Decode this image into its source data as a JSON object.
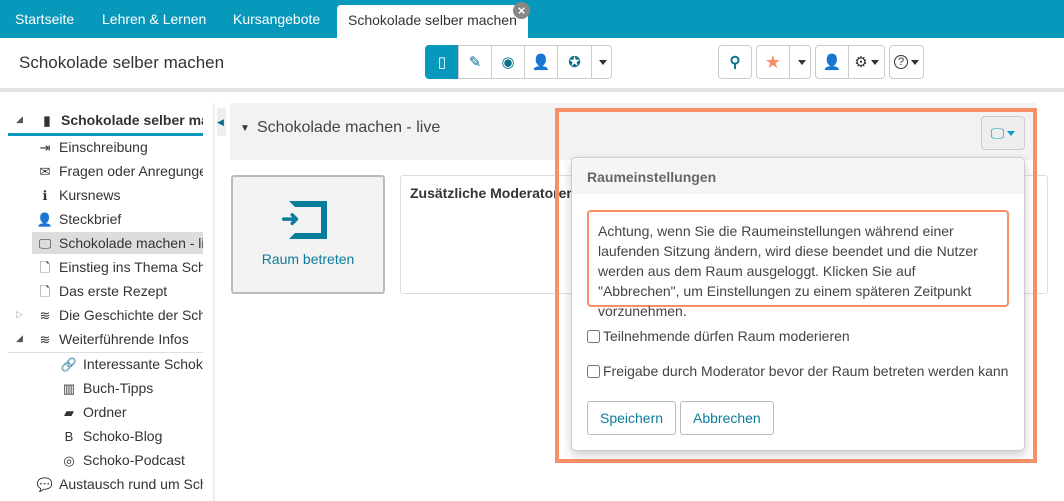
{
  "colors": {
    "brand": "#0898bb",
    "highlight": "#f79068"
  },
  "topnav": {
    "tabs": [
      "Startseite",
      "Lehren & Lernen",
      "Kursangebote"
    ],
    "active_tab": "Schokolade selber machen",
    "close": "×"
  },
  "header": {
    "title": "Schokolade selber machen"
  },
  "toolbar": {
    "icons": [
      "book-icon",
      "pencil-icon",
      "preview-icon",
      "members-icon",
      "assessment-icon"
    ],
    "caret": "more"
  },
  "tools": {
    "search": "search-icon",
    "favorite": "star-icon",
    "user": "user-globe-icon",
    "settings": "gears-icon",
    "help": "?"
  },
  "sidebar": {
    "root": "Schokolade selber machen",
    "items": [
      {
        "label": "Einschreibung",
        "icon": "⇥"
      },
      {
        "label": "Fragen oder Anregungen",
        "icon": "✉"
      },
      {
        "label": "Kursnews",
        "icon": "ℹ"
      },
      {
        "label": "Steckbrief",
        "icon": "👤"
      },
      {
        "label": "Schokolade machen - live",
        "icon": "🖵"
      },
      {
        "label": "Einstieg ins Thema Schokolade",
        "icon": "🗋"
      },
      {
        "label": "Das erste Rezept",
        "icon": "🗋"
      },
      {
        "label": "Die Geschichte der Schokolade",
        "icon": "≋"
      },
      {
        "label": "Weiterführende Infos",
        "icon": "≋"
      },
      {
        "label": "Interessante Schokoladenseiten",
        "icon": "🔗"
      },
      {
        "label": "Buch-Tipps",
        "icon": "▥"
      },
      {
        "label": "Ordner",
        "icon": "▰"
      },
      {
        "label": "Schoko-Blog",
        "icon": "B"
      },
      {
        "label": "Schoko-Podcast",
        "icon": "◎"
      },
      {
        "label": "Austausch rund um Schokolade",
        "icon": "💬"
      }
    ]
  },
  "main": {
    "title": "Schokolade machen - live",
    "room_button": "Raum betreten",
    "moderators_label": "Zusätzliche Moderatoren:"
  },
  "popover": {
    "title": "Raumeinstellungen",
    "warning": "Achtung, wenn Sie die Raumeinstellungen während einer laufenden Sitzung ändern, wird diese beendet und die Nutzer werden aus dem Raum ausgeloggt. Klicken Sie auf \"Abbrechen\", um Einstellungen zu einem späteren Zeitpunkt vorzunehmen.",
    "option1": "Teilnehmende dürfen Raum moderieren",
    "option2": "Freigabe durch Moderator bevor der Raum betreten werden kann",
    "save": "Speichern",
    "cancel": "Abbrechen"
  }
}
